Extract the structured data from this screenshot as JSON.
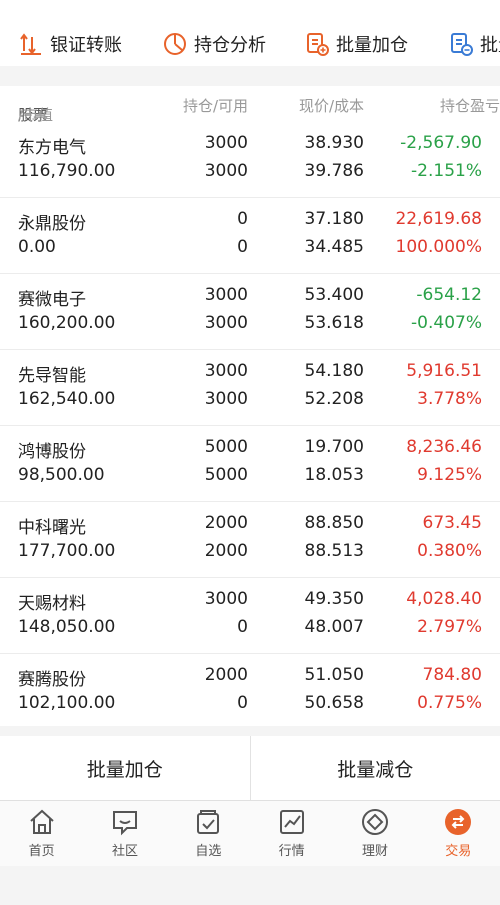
{
  "actions": [
    {
      "label": "银证转账",
      "icon": "bank-transfer-icon"
    },
    {
      "label": "持仓分析",
      "icon": "pie-chart-icon"
    },
    {
      "label": "批量加仓",
      "icon": "batch-add-icon"
    },
    {
      "label": "批量",
      "icon": "batch-reduce-icon"
    }
  ],
  "table": {
    "headers": {
      "stock": "股票",
      "market_value": "/市值",
      "holding": "持仓/可用",
      "price": "现价/成本",
      "pl": "持仓盈亏"
    },
    "rows": [
      {
        "name": "东方电气",
        "market_value": "116,790.00",
        "holding": "3000",
        "available": "3000",
        "price": "38.930",
        "cost": "39.786",
        "pl": "-2,567.90",
        "pl_pct": "-2.151%",
        "trend": "down"
      },
      {
        "name": "永鼎股份",
        "market_value": "0.00",
        "holding": "0",
        "available": "0",
        "price": "37.180",
        "cost": "34.485",
        "pl": "22,619.68",
        "pl_pct": "100.000%",
        "trend": "up"
      },
      {
        "name": "赛微电子",
        "market_value": "160,200.00",
        "holding": "3000",
        "available": "3000",
        "price": "53.400",
        "cost": "53.618",
        "pl": "-654.12",
        "pl_pct": "-0.407%",
        "trend": "down"
      },
      {
        "name": "先导智能",
        "market_value": "162,540.00",
        "holding": "3000",
        "available": "3000",
        "price": "54.180",
        "cost": "52.208",
        "pl": "5,916.51",
        "pl_pct": "3.778%",
        "trend": "up"
      },
      {
        "name": "鸿博股份",
        "market_value": "98,500.00",
        "holding": "5000",
        "available": "5000",
        "price": "19.700",
        "cost": "18.053",
        "pl": "8,236.46",
        "pl_pct": "9.125%",
        "trend": "up"
      },
      {
        "name": "中科曙光",
        "market_value": "177,700.00",
        "holding": "2000",
        "available": "2000",
        "price": "88.850",
        "cost": "88.513",
        "pl": "673.45",
        "pl_pct": "0.380%",
        "trend": "up"
      },
      {
        "name": "天赐材料",
        "market_value": "148,050.00",
        "holding": "3000",
        "available": "0",
        "price": "49.350",
        "cost": "48.007",
        "pl": "4,028.40",
        "pl_pct": "2.797%",
        "trend": "up"
      },
      {
        "name": "赛腾股份",
        "market_value": "102,100.00",
        "holding": "2000",
        "available": "0",
        "price": "51.050",
        "cost": "50.658",
        "pl": "784.80",
        "pl_pct": "0.775%",
        "trend": "up"
      }
    ]
  },
  "batch": {
    "add": "批量加仓",
    "reduce": "批量减仓"
  },
  "tabs": [
    {
      "label": "首页",
      "icon": "home-icon"
    },
    {
      "label": "社区",
      "icon": "community-icon"
    },
    {
      "label": "自选",
      "icon": "watchlist-icon"
    },
    {
      "label": "行情",
      "icon": "market-icon"
    },
    {
      "label": "理财",
      "icon": "wealth-icon"
    },
    {
      "label": "交易",
      "icon": "trade-icon",
      "active": true
    }
  ],
  "colors": {
    "accent": "#e8632b",
    "up": "#e03a2f",
    "down": "#2aa148"
  }
}
